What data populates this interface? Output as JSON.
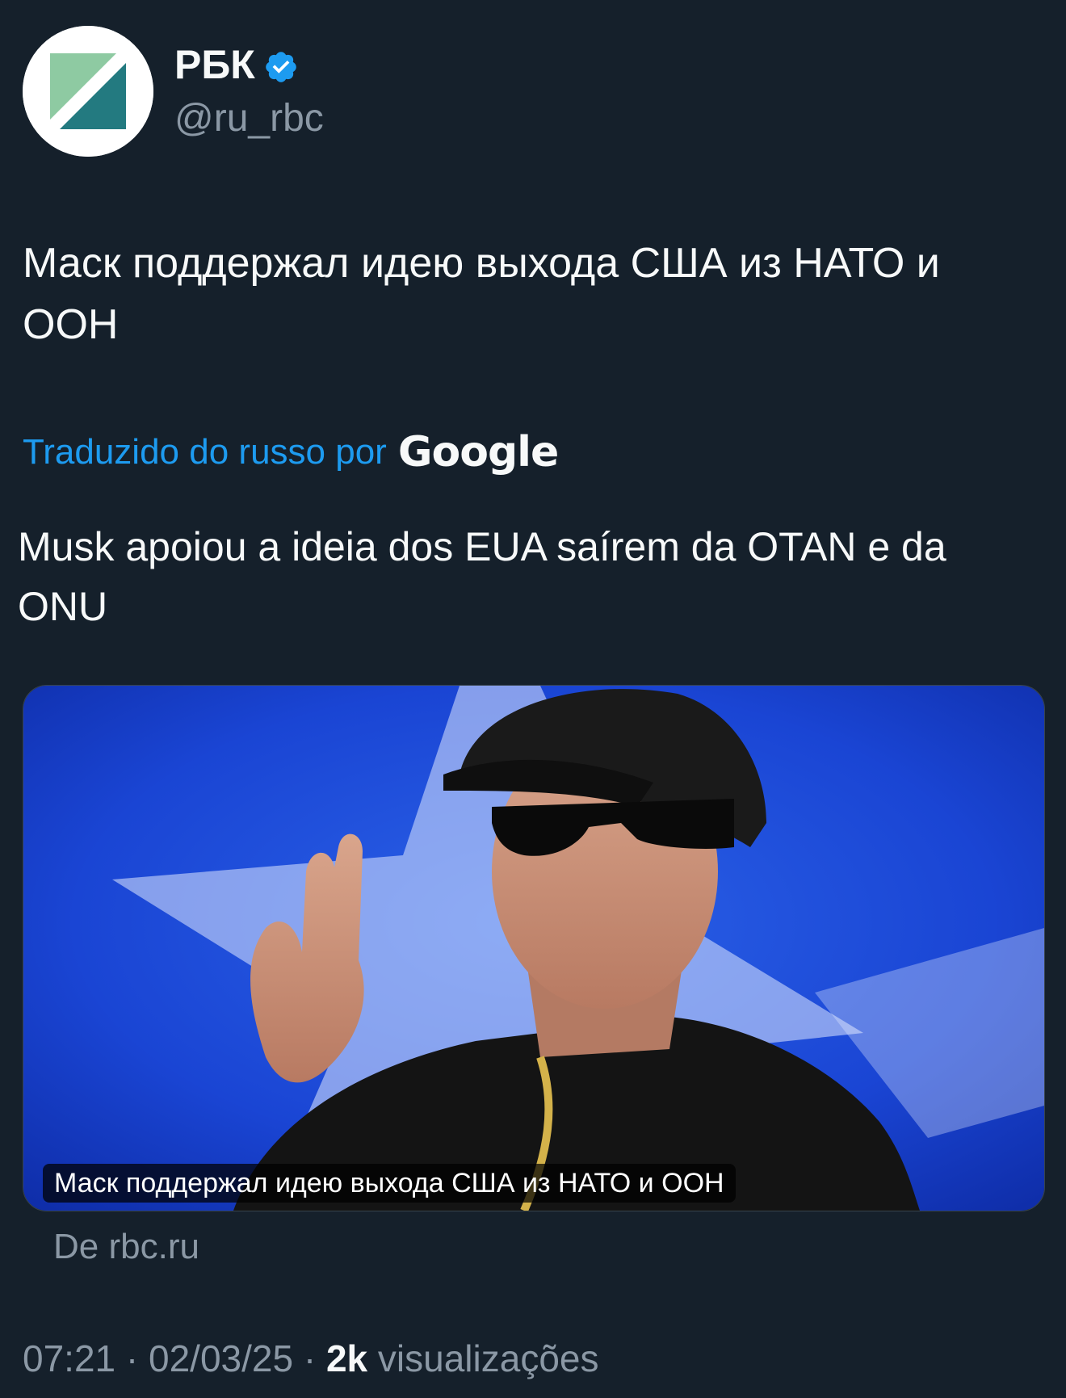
{
  "author": {
    "name": "РБК",
    "handle": "@ru_rbc",
    "verified_icon": "verified-badge-icon",
    "avatar_icon": "rbc-logo"
  },
  "tweet": {
    "text": "Маск поддержал идею выхода США из НАТО и ООН"
  },
  "translation": {
    "label": "Traduzido do russo por",
    "provider": "Google",
    "text": "Musk apoiou a ideia dos EUA saírem da OTAN e da ONU"
  },
  "card": {
    "caption": "Маск поддержал идею выхода США из НАТО и ООН",
    "source": "De rbc.ru"
  },
  "meta": {
    "time": "07:21",
    "separator": "·",
    "date": "02/03/25",
    "views_count": "2k",
    "views_label": "visualizações"
  },
  "colors": {
    "background": "#15202b",
    "accent": "#1d9bf0",
    "secondary_text": "#8b98a5"
  }
}
